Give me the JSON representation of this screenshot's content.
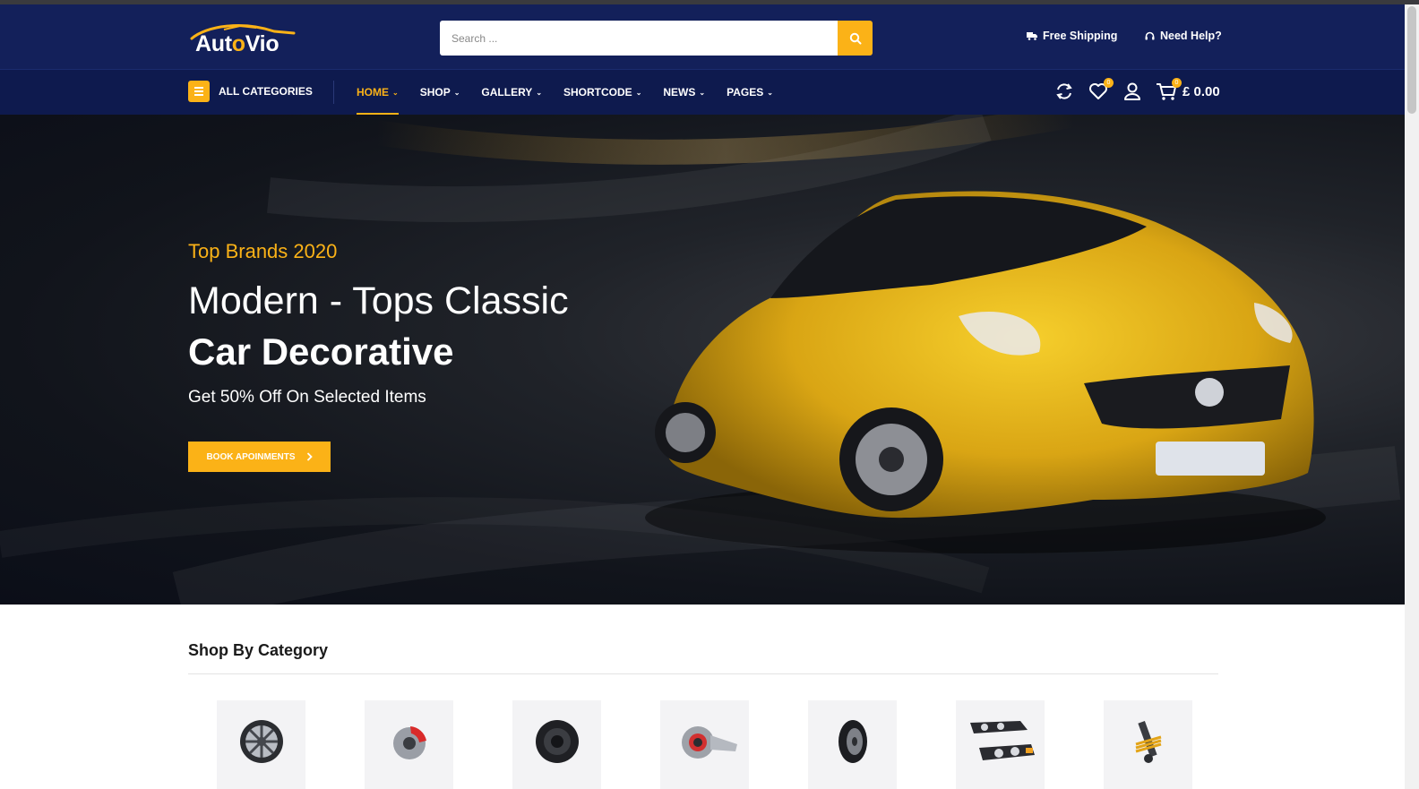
{
  "brand": {
    "logo_part1": "Aut",
    "logo_o": "o",
    "logo_part2": "Vio",
    "accent": "#fbb217",
    "navy": "#13205a"
  },
  "header": {
    "search_placeholder": "Search ...",
    "free_shipping": "Free Shipping",
    "need_help": "Need Help?",
    "icons": {
      "search": "search-icon",
      "shipping": "truck-icon",
      "help": "headset-icon"
    }
  },
  "nav": {
    "all_categories": "ALL CATEGORIES",
    "items": [
      {
        "label": "HOME",
        "active": true
      },
      {
        "label": "SHOP"
      },
      {
        "label": "GALLERY"
      },
      {
        "label": "SHORTCODE"
      },
      {
        "label": "NEWS"
      },
      {
        "label": "PAGES"
      }
    ],
    "wishlist_count": "0",
    "cart_count": "0",
    "cart_total": "£ 0.00"
  },
  "hero": {
    "subtitle": "Top Brands 2020",
    "title_line1": "Modern - Tops Classic",
    "title_line2": "Car Decorative",
    "description": "Get 50% Off On Selected Items",
    "button_label": "BOOK APOINMENTS"
  },
  "categories": {
    "title": "Shop By Category",
    "items": [
      "alloy-wheel-icon",
      "brake-disc-icon",
      "speaker-icon",
      "turbocharger-icon",
      "tire-icon",
      "headlight-icon",
      "shock-absorber-icon"
    ]
  }
}
